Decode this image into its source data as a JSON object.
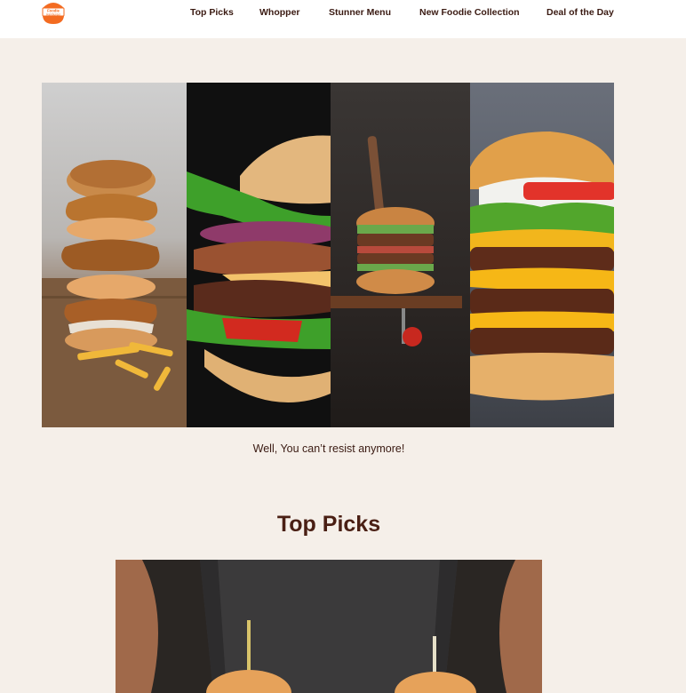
{
  "brand": {
    "logo_line1": "Foodie",
    "logo_line2": "Hamburger",
    "accent": "#f36b21",
    "dark": "#4a1f14",
    "background": "#f5efe9"
  },
  "nav": {
    "items": [
      {
        "label": "Top Picks"
      },
      {
        "label": "Whopper"
      },
      {
        "label": "Stunner Menu"
      },
      {
        "label": "New Foodie Collection"
      },
      {
        "label": "Deal of the Day"
      }
    ]
  },
  "hero": {
    "caption": "Well, You can’t resist anymore!"
  },
  "top_picks": {
    "title": "Top Picks"
  }
}
